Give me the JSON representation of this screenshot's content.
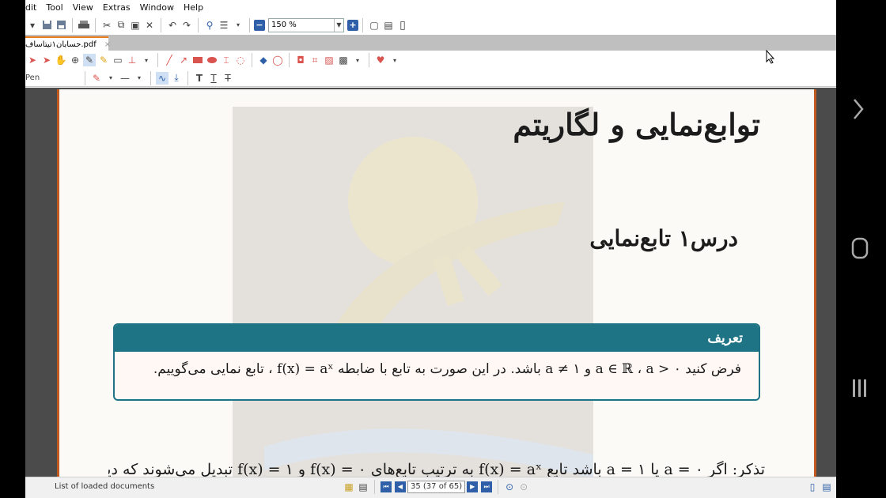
{
  "menu": {
    "items": [
      "dit",
      "Tool",
      "View",
      "Extras",
      "Window",
      "Help"
    ]
  },
  "toolbar": {
    "zoom_value": "150 %"
  },
  "tab": {
    "title": "حسابان۱تیتاساف.pdf"
  },
  "toolbar3": {
    "tool_name": "Pen"
  },
  "document": {
    "title": "توابع‌نمایی و لگاریتم",
    "lesson": "درس۱   تابع‌نمایی",
    "definition_heading": "تعریف",
    "definition_text": "فرض کنید a ∈ ℝ ، a > ۰ و a ≠ ۱ باشد. در این صورت به تابع با ضابطه f(x) = aˣ ، تابع نمایی می‌گوییم.",
    "cut_line": "تذکر: اگر a = ۰ یا a = ۱ باشد تابع f(x) = aˣ به ترتیب تابع‌های f(x) = ۰ و f(x) = ۱ تبدیل می‌شوند که دیگر آنها"
  },
  "status": {
    "loaded_docs": "List of loaded documents",
    "page_indicator": "35 (37 of 65)"
  },
  "colors": {
    "accent": "#1e7485",
    "page_border": "#c15a1f",
    "tab_accent": "#e87d1e"
  }
}
